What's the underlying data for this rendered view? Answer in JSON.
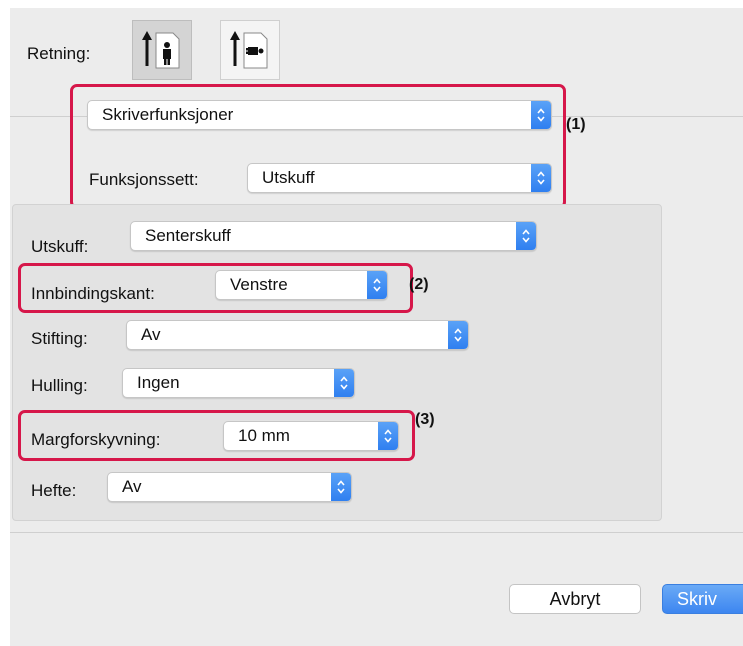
{
  "orientation": {
    "label": "Retning:",
    "portrait_icon": "portrait-person-icon",
    "landscape_icon": "landscape-person-icon"
  },
  "section_menu": {
    "value": "Skriverfunksjoner"
  },
  "feature_set": {
    "label": "Funksjonssett:",
    "value": "Utskuff"
  },
  "output_tray": {
    "label": "Utskuff:",
    "value": "Senterskuff"
  },
  "binding_edge": {
    "label": "Innbindingskant:",
    "value": "Venstre"
  },
  "stapling": {
    "label": "Stifting:",
    "value": "Av"
  },
  "punching": {
    "label": "Hulling:",
    "value": "Ingen"
  },
  "margin_shift": {
    "label": "Margforskyvning:",
    "value": "10 mm"
  },
  "booklet": {
    "label": "Hefte:",
    "value": "Av"
  },
  "buttons": {
    "cancel": "Avbryt",
    "print": "Skriv"
  },
  "callouts": [
    "(1)",
    "(2)",
    "(3)"
  ],
  "colors": {
    "highlight": "#d6174a",
    "accent": "#2f7ff0"
  }
}
